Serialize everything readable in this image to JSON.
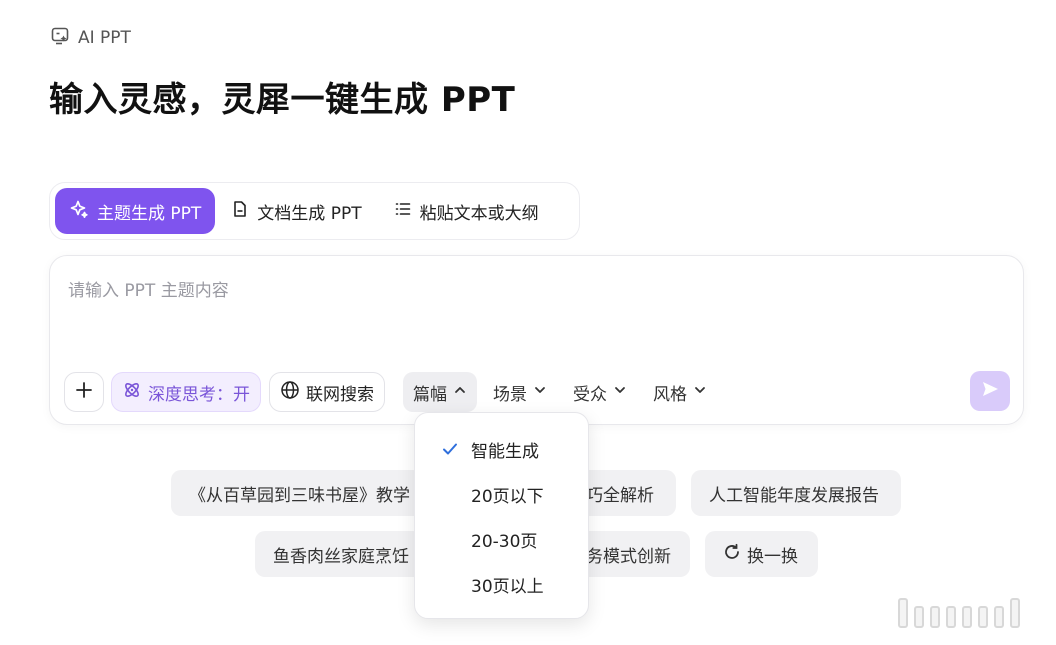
{
  "brand": {
    "label": "AI PPT",
    "icon": "ai-ppt-icon"
  },
  "hero": {
    "title": "输入灵感，灵犀一键生成 PPT"
  },
  "modes": {
    "tabs": [
      {
        "label": "主题生成 PPT",
        "icon": "sparkle-icon",
        "active": true
      },
      {
        "label": "文档生成 PPT",
        "icon": "document-icon",
        "active": false
      },
      {
        "label": "粘贴文本或大纲",
        "icon": "list-icon",
        "active": false
      }
    ]
  },
  "prompt": {
    "placeholder": "请输入 PPT 主题内容",
    "value": ""
  },
  "toolbar": {
    "deep_think": "深度思考：开",
    "web_search": "联网搜索",
    "length": "篇幅",
    "scene": "场景",
    "audience": "受众",
    "style": "风格"
  },
  "length_menu": {
    "selected": "智能生成",
    "options": [
      "智能生成",
      "20页以下",
      "20-30页",
      "30页以上"
    ]
  },
  "suggestions": {
    "row1": [
      "《从百草园到三味书屋》教学",
      "巧全解析",
      "人工智能年度发展报告"
    ],
    "row2": [
      "鱼香肉丝家庭烹饪",
      "务模式创新"
    ],
    "refresh": "换一换"
  },
  "colors": {
    "accent": "#7f54ee",
    "accent_light": "#f3eefe",
    "send_disabled": "#d9cbfa",
    "check": "#2f6fdc"
  }
}
